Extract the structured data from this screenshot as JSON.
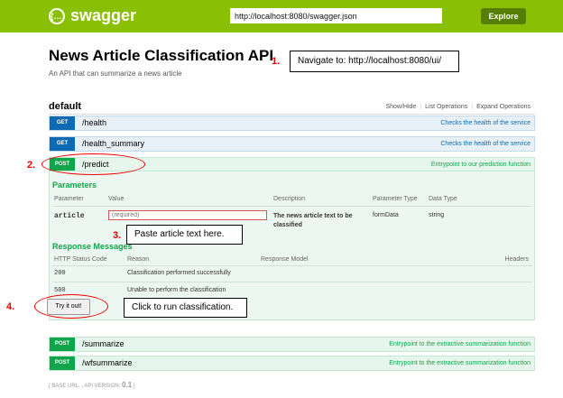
{
  "header": {
    "logo_glyph": "{…}",
    "logo_text": "swagger",
    "url_value": "http://localhost:8080/swagger.json",
    "explore_label": "Explore"
  },
  "api": {
    "title": "News Article Classification API",
    "description": "An API that can summarize a news article"
  },
  "section": {
    "name": "default",
    "links": [
      "Show/Hide",
      "List Operations",
      "Expand Operations"
    ]
  },
  "operations": [
    {
      "method": "GET",
      "path": "/health",
      "description": "Checks the health of the service"
    },
    {
      "method": "GET",
      "path": "/health_summary",
      "description": "Checks the health of the service"
    },
    {
      "method": "POST",
      "path": "/predict",
      "description": "Entrypoint to our prediction function"
    },
    {
      "method": "POST",
      "path": "/summarize",
      "description": "Entrypoint to the extractive summarization function"
    },
    {
      "method": "POST",
      "path": "/wfsummarize",
      "description": "Entrypoint to the extractive summarization function"
    }
  ],
  "parameters": {
    "heading": "Parameters",
    "columns": [
      "Parameter",
      "Value",
      "Description",
      "Parameter Type",
      "Data Type"
    ],
    "rows": [
      {
        "name": "article",
        "placeholder": "(required)",
        "description": "The news article text to be classified",
        "param_type": "formData",
        "data_type": "string"
      }
    ]
  },
  "responses": {
    "heading": "Response Messages",
    "columns": [
      "HTTP Status Code",
      "Reason",
      "Response Model",
      "Headers"
    ],
    "rows": [
      {
        "code": "200",
        "reason": "Classification performed successfully"
      },
      {
        "code": "500",
        "reason": "Unable to perform the classification"
      }
    ]
  },
  "try_button_label": "Try it out!",
  "annotations": [
    {
      "num": "1.",
      "text": "Navigate to: http://localhost:8080/ui/"
    },
    {
      "num": "2.",
      "text": ""
    },
    {
      "num": "3.",
      "text": "Paste article text here."
    },
    {
      "num": "4.",
      "text": "Click to run classification."
    }
  ],
  "footer": {
    "base_url_label": "[ BASE URL: , API VERSION:",
    "version": "0.1",
    "close": "]"
  },
  "colors": {
    "header_bg": "#89bf04",
    "get_badge": "#0f6ab4",
    "post_badge": "#10a54a",
    "annotation_red": "#e00000"
  }
}
